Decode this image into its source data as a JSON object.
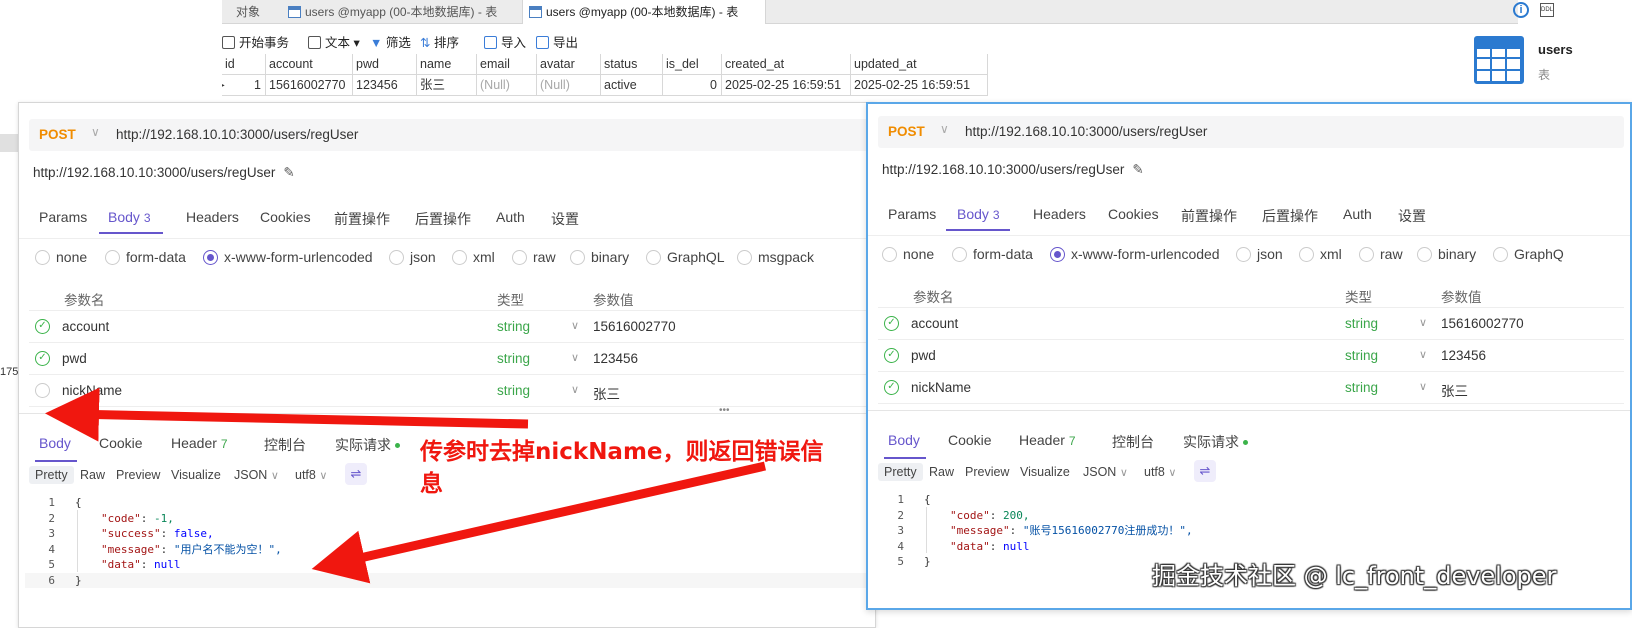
{
  "db": {
    "tabs": [
      {
        "label": "对象"
      },
      {
        "label": "users @myapp (00-本地数据库) - 表"
      },
      {
        "label": "users @myapp (00-本地数据库) - 表"
      }
    ],
    "toolbar": [
      "开始事务",
      "文本",
      "筛选",
      "排序",
      "导入",
      "导出"
    ],
    "columns": [
      "id",
      "account",
      "pwd",
      "name",
      "email",
      "avatar",
      "status",
      "is_del",
      "created_at",
      "updated_at"
    ],
    "row": [
      "1",
      "15616002770",
      "123456",
      "张三",
      "(Null)",
      "(Null)",
      "active",
      "0",
      "2025-02-25 16:59:51",
      "2025-02-25 16:59:51"
    ],
    "right_title": "users",
    "right_sub": "表"
  },
  "left": {
    "method": "POST",
    "url": "http://192.168.10.10:3000/users/regUser",
    "name": "http://192.168.10.10:3000/users/regUser",
    "tabs": [
      "Params",
      "Body",
      "Headers",
      "Cookies",
      "前置操作",
      "后置操作",
      "Auth",
      "设置"
    ],
    "body_count": "3",
    "body_types": [
      "none",
      "form-data",
      "x-www-form-urlencoded",
      "json",
      "xml",
      "raw",
      "binary",
      "GraphQL",
      "msgpack"
    ],
    "param_headers": [
      "参数名",
      "类型",
      "参数值"
    ],
    "params": [
      {
        "name": "account",
        "type": "string",
        "value": "15616002770"
      },
      {
        "name": "pwd",
        "type": "string",
        "value": "123456"
      },
      {
        "name": "nickName",
        "type": "string",
        "value": "张三"
      }
    ],
    "resp_tabs": [
      "Body",
      "Cookie",
      "Header",
      "控制台",
      "实际请求"
    ],
    "header_count": "7",
    "formats": [
      "Pretty",
      "Raw",
      "Preview",
      "Visualize",
      "JSON",
      "utf8"
    ],
    "code": [
      {
        "n": "1",
        "t": "{"
      },
      {
        "n": "2",
        "k": "\"code\"",
        "v": "-1,",
        "c": "num"
      },
      {
        "n": "3",
        "k": "\"success\"",
        "v": "false,",
        "c": "kw"
      },
      {
        "n": "4",
        "k": "\"message\"",
        "v": "\"用户名不能为空！\",",
        "c": "str"
      },
      {
        "n": "5",
        "k": "\"data\"",
        "v": "null",
        "c": "kw"
      },
      {
        "n": "6",
        "t": "}"
      }
    ]
  },
  "right": {
    "method": "POST",
    "url": "http://192.168.10.10:3000/users/regUser",
    "name": "http://192.168.10.10:3000/users/regUser",
    "tabs": [
      "Params",
      "Body",
      "Headers",
      "Cookies",
      "前置操作",
      "后置操作",
      "Auth",
      "设置"
    ],
    "body_count": "3",
    "body_types": [
      "none",
      "form-data",
      "x-www-form-urlencoded",
      "json",
      "xml",
      "raw",
      "binary",
      "GraphQ"
    ],
    "param_headers": [
      "参数名",
      "类型",
      "参数值"
    ],
    "params": [
      {
        "name": "account",
        "type": "string",
        "value": "15616002770"
      },
      {
        "name": "pwd",
        "type": "string",
        "value": "123456"
      },
      {
        "name": "nickName",
        "type": "string",
        "value": "张三"
      }
    ],
    "resp_tabs": [
      "Body",
      "Cookie",
      "Header",
      "控制台",
      "实际请求"
    ],
    "header_count": "7",
    "formats": [
      "Pretty",
      "Raw",
      "Preview",
      "Visualize",
      "JSON",
      "utf8"
    ],
    "code": [
      {
        "n": "1",
        "t": "{"
      },
      {
        "n": "2",
        "k": "\"code\"",
        "v": "200,",
        "c": "num"
      },
      {
        "n": "3",
        "k": "\"message\"",
        "v": "\"账号15616002770注册成功！\",",
        "c": "str"
      },
      {
        "n": "4",
        "k": "\"data\"",
        "v": "null",
        "c": "kw"
      },
      {
        "n": "5",
        "t": "}"
      }
    ]
  },
  "annotation": {
    "line1": "传参时去掉nickName，则返回错误信",
    "line2": "息",
    "color": "#f0170f"
  },
  "watermark": "掘金技术社区 @ lc_front_developer",
  "stray": [
    "175"
  ]
}
